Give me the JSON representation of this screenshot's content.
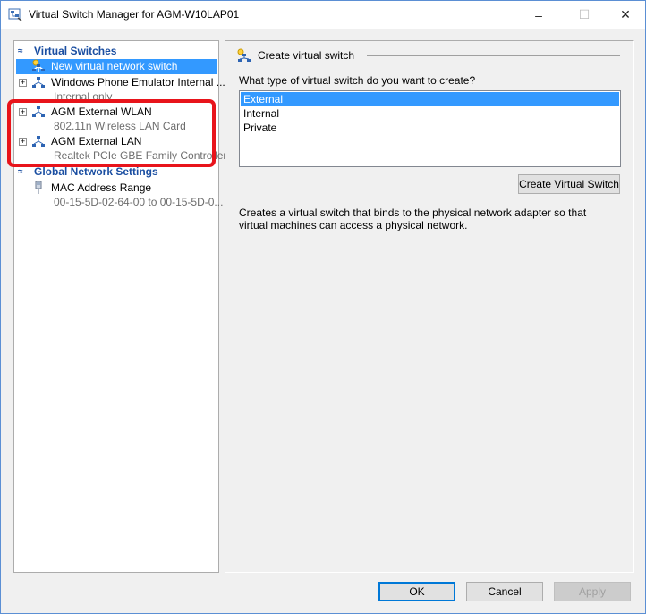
{
  "window": {
    "title": "Virtual Switch Manager for AGM-W10LAP01",
    "controls": {
      "minimize": "–",
      "maximize": "☐",
      "close": "✕"
    }
  },
  "left_panel": {
    "virtual_switches_header": "Virtual Switches",
    "items": [
      {
        "label": "New virtual network switch",
        "sub": "",
        "selected": true
      },
      {
        "label": "Windows Phone Emulator Internal ...",
        "sub": "Internal only",
        "selected": false
      },
      {
        "label": "AGM External WLAN",
        "sub": "802.11n Wireless LAN Card",
        "selected": false
      },
      {
        "label": "AGM External LAN",
        "sub": "Realtek PCIe GBE Family Controller",
        "selected": false
      }
    ],
    "global_header": "Global Network Settings",
    "global_items": [
      {
        "label": "MAC Address Range",
        "sub": "00-15-5D-02-64-00 to 00-15-5D-0..."
      }
    ],
    "expander_symbol": "+",
    "collapse_symbol": "≈"
  },
  "right_panel": {
    "header": "Create virtual switch",
    "question": "What type of virtual switch do you want to create?",
    "types": [
      "External",
      "Internal",
      "Private"
    ],
    "selected_type": "External",
    "create_button": "Create Virtual Switch",
    "description": "Creates a virtual switch that binds to the physical network adapter so that virtual machines can access a physical network."
  },
  "footer": {
    "ok": "OK",
    "cancel": "Cancel",
    "apply": "Apply"
  },
  "colors": {
    "accent": "#3399ff",
    "section_header": "#1a4ea1",
    "highlight": "#e8141b"
  }
}
